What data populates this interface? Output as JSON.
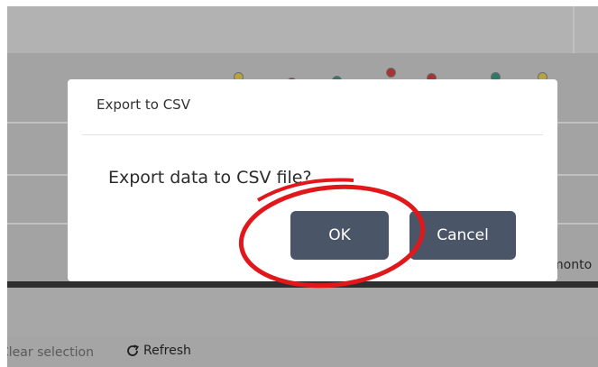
{
  "map": {
    "partial_label": "monto",
    "markers": [
      {
        "color": "yellow"
      },
      {
        "color": "red"
      },
      {
        "color": "green"
      },
      {
        "color": "red"
      },
      {
        "color": "red"
      },
      {
        "color": "green"
      },
      {
        "color": "yellow"
      }
    ]
  },
  "toolbar": {
    "clear_selection_label": "Clear selection",
    "refresh_label": "Refresh",
    "refresh_icon": "refresh-icon"
  },
  "dialog": {
    "title": "Export to CSV",
    "message": "Export data to CSV file?",
    "ok_label": "OK",
    "cancel_label": "Cancel"
  },
  "annotation": {
    "shape": "ellipse",
    "color": "#e0181b",
    "target": "ok-button"
  },
  "colors": {
    "overlay": "#a3a3a3",
    "button": "#4a5668",
    "dialog_bg": "#ffffff",
    "splitter": "#2f2f2f"
  }
}
